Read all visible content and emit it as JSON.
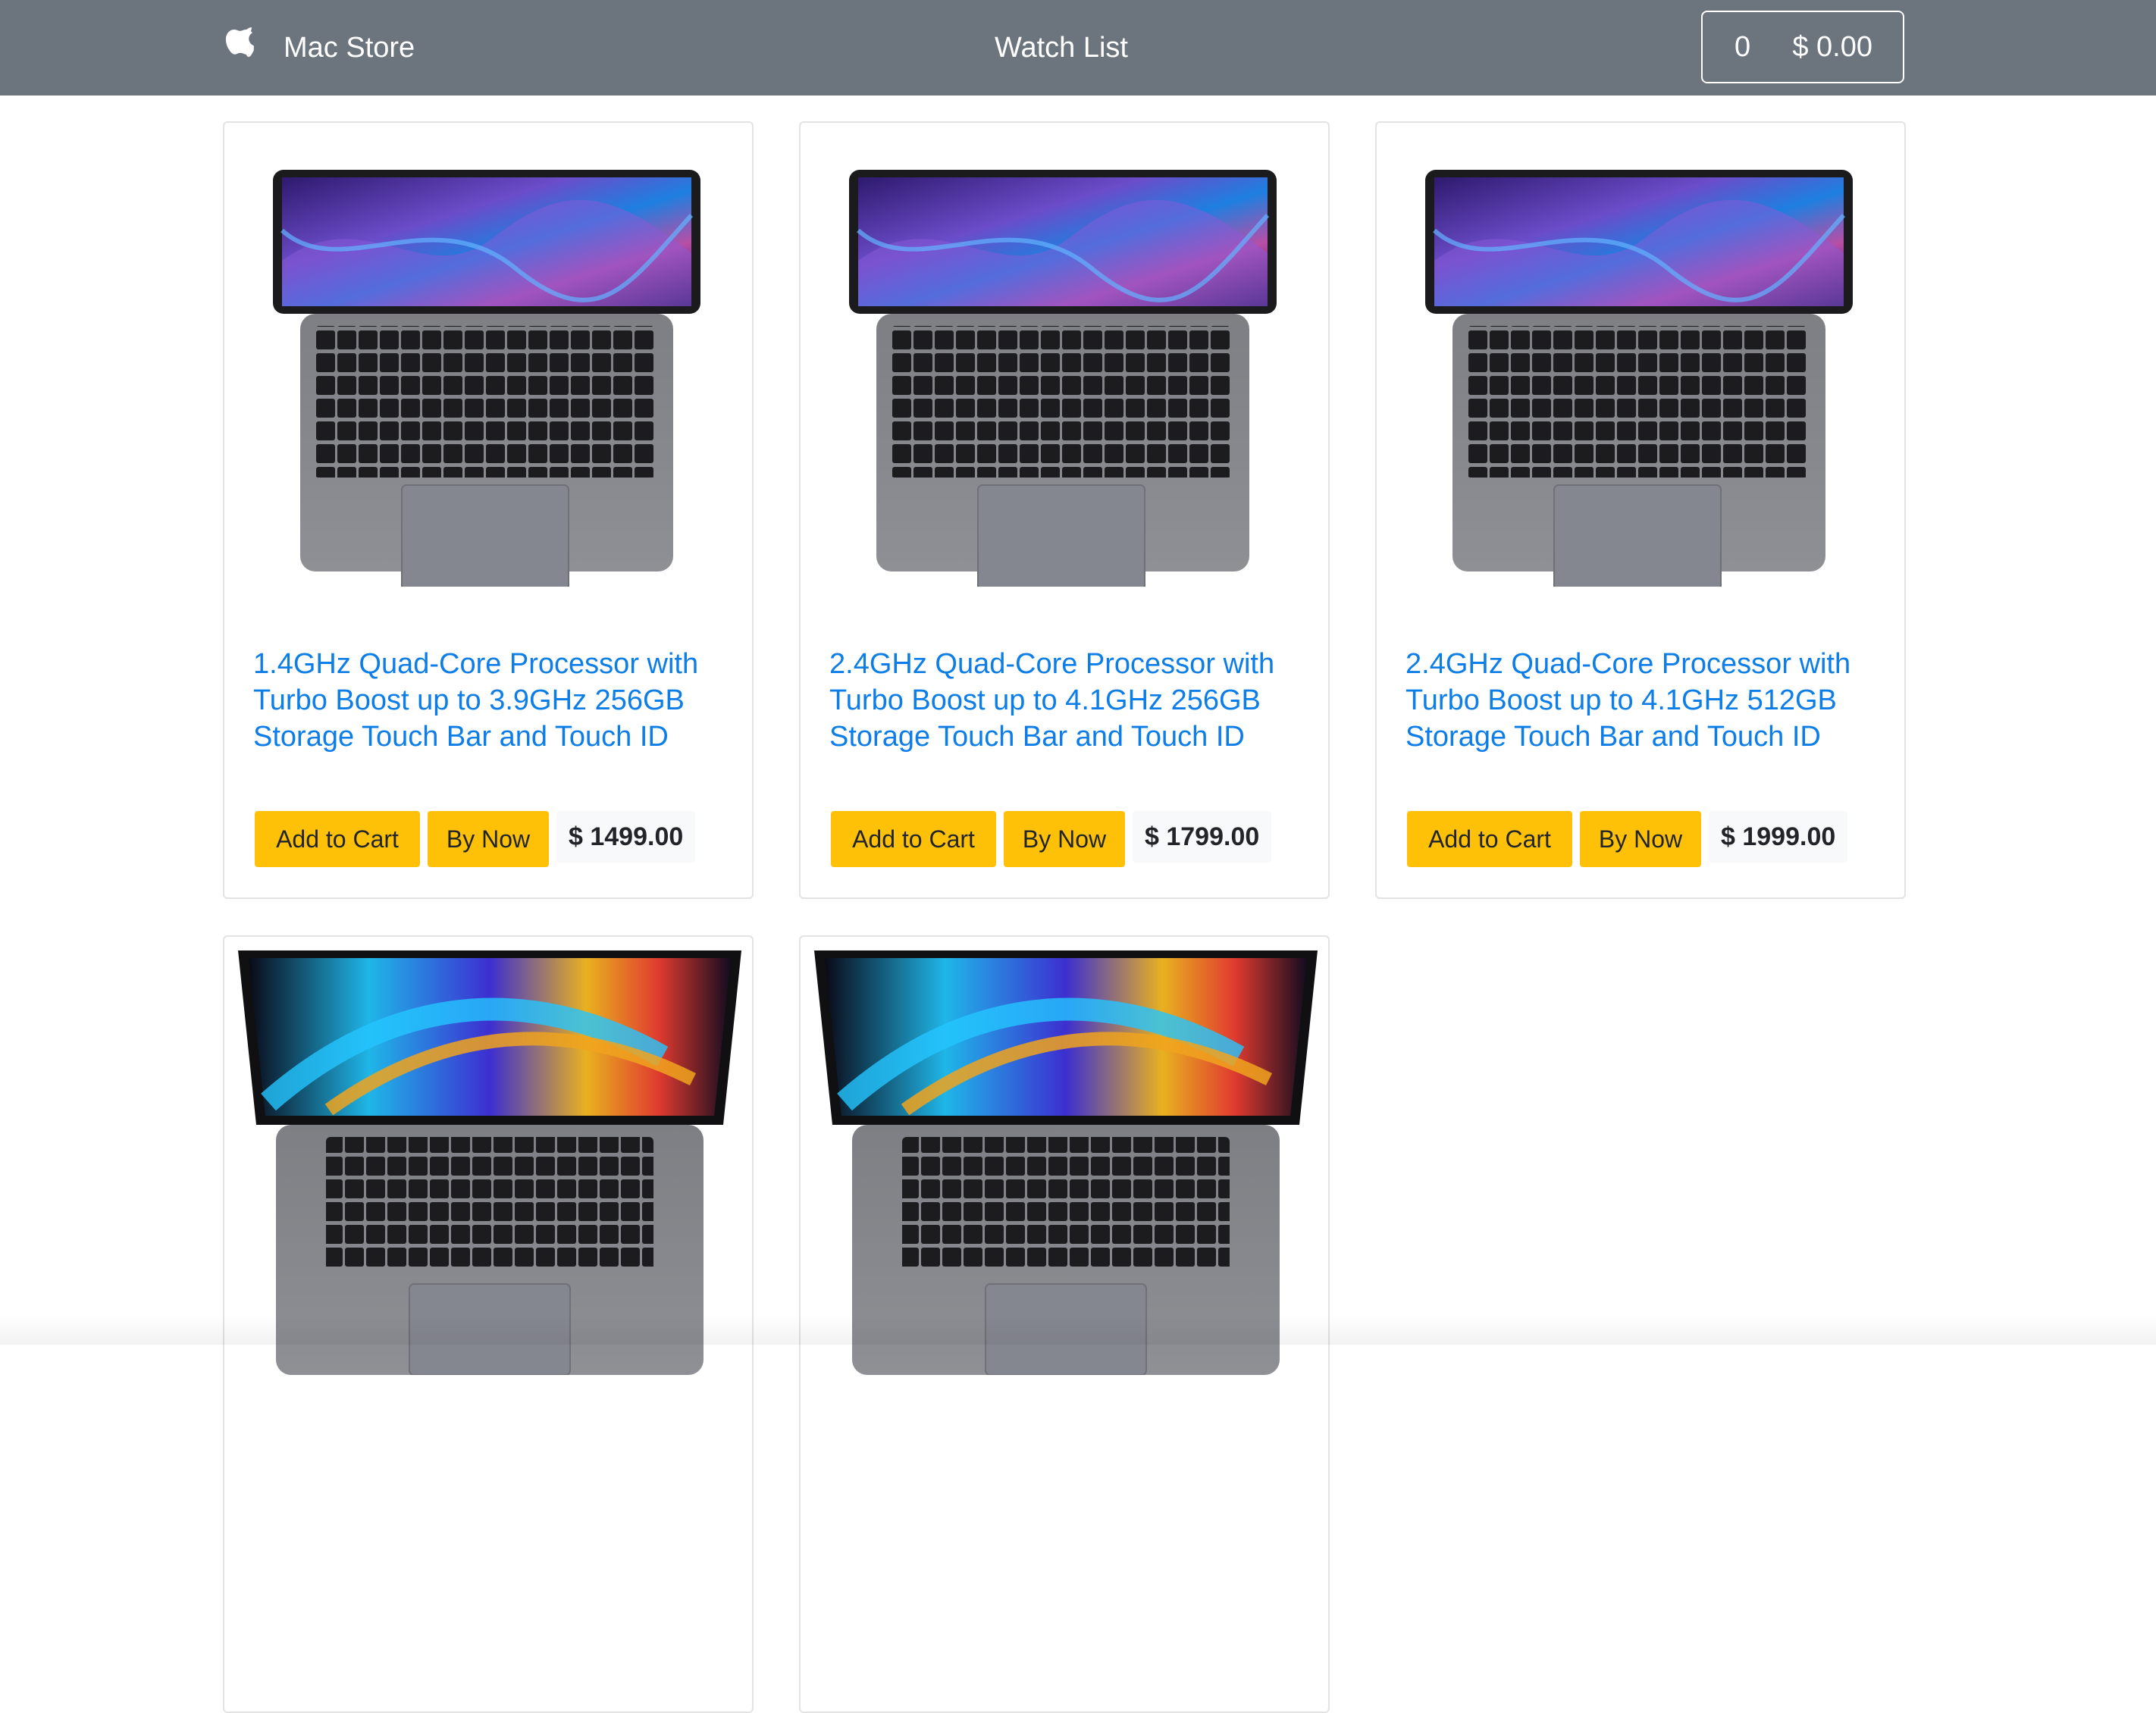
{
  "navbar": {
    "brand": {
      "icon": "apple-logo-icon",
      "label": "Mac Store"
    },
    "watchlist": "Watch List",
    "cart": {
      "count": "0",
      "total": "$ 0.00"
    }
  },
  "products": [
    {
      "title": "1.4GHz Quad-Core Processor with Turbo Boost up to 3.9GHz 256GB Storage Touch Bar and Touch ID",
      "add_to_cart": "Add to Cart",
      "buy_now": "By Now",
      "price": "$ 1499.00",
      "image": "macbook-pro-13-icon"
    },
    {
      "title": "2.4GHz Quad-Core Processor with Turbo Boost up to 4.1GHz 256GB Storage Touch Bar and Touch ID",
      "add_to_cart": "Add to Cart",
      "buy_now": "By Now",
      "price": "$ 1799.00",
      "image": "macbook-pro-13-icon"
    },
    {
      "title": "2.4GHz Quad-Core Processor with Turbo Boost up to 4.1GHz 512GB Storage Touch Bar and Touch ID",
      "add_to_cart": "Add to Cart",
      "buy_now": "By Now",
      "price": "$ 1999.00",
      "image": "macbook-pro-13-icon"
    },
    {
      "image": "macbook-pro-16-icon"
    },
    {
      "image": "macbook-pro-16-icon"
    }
  ],
  "colors": {
    "navbar": "#6c757d",
    "accent_link": "#0d7ee8",
    "button": "#ffc107"
  }
}
